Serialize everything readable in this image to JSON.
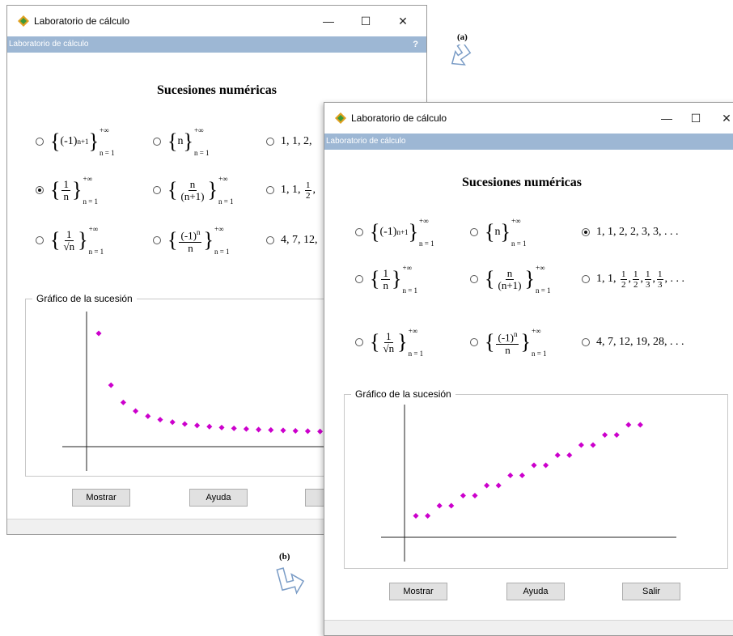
{
  "app": {
    "title": "Laboratorio de cálculo",
    "menu_label": "Laboratorio de cálculo",
    "help_mark": "?",
    "minimize": "—",
    "maximize": "☐",
    "close": "✕"
  },
  "heading": "Sucesiones numéricas",
  "options_text": {
    "list_1": "1, 1, 2, 2, 3, 3, . . .",
    "list_1_truncated": "1, 1, 2,",
    "list_2_prefix": "1, 1,",
    "list_2_suffix": ", . . .",
    "list_3": "4, 7, 12, 19, 28, . . .",
    "list_3_truncated": "4, 7, 12,"
  },
  "math_tokens": {
    "neg_one": "(-1)",
    "n_plus_1": "n+1",
    "n": "n",
    "inf": "+∞",
    "n_eq_1": "n = 1",
    "one": "1",
    "n_plus_1_paren": "(n+1)",
    "sqrt_n": "√n",
    "neg_one_n": "(-1)",
    "two": "2",
    "three": "3"
  },
  "graph_label": "Gráfico de la sucesión",
  "buttons": {
    "show": "Mostrar",
    "help": "Ayuda",
    "exit": "Salir",
    "exit_truncated": "S"
  },
  "captions": {
    "a": "(a)",
    "b": "(b)"
  },
  "windows": [
    {
      "selected_option": "1/n"
    },
    {
      "selected_option": "1, 1, 2, 2, 3, 3, . . ."
    }
  ],
  "chart_data": [
    {
      "type": "scatter",
      "series": [
        {
          "values": [
            1,
            0.5,
            0.333,
            0.25,
            0.2,
            0.167,
            0.143,
            0.125,
            0.111,
            0.1,
            0.091,
            0.083,
            0.077,
            0.071,
            0.067,
            0.063,
            0.059,
            0.056,
            0.053
          ]
        }
      ],
      "x": [
        1,
        2,
        3,
        4,
        5,
        6,
        7,
        8,
        9,
        10,
        11,
        12,
        13,
        14,
        15,
        16,
        17,
        18,
        19
      ],
      "color": "#cc00cc",
      "axes_visible": true,
      "grid": false
    },
    {
      "type": "scatter",
      "series": [
        {
          "values": [
            1,
            1,
            2,
            2,
            3,
            3,
            4,
            4,
            5,
            5,
            6,
            6,
            7,
            7,
            8,
            8,
            9,
            9,
            10,
            10
          ]
        }
      ],
      "x": [
        1,
        2,
        3,
        4,
        5,
        6,
        7,
        8,
        9,
        10,
        11,
        12,
        13,
        14,
        15,
        16,
        17,
        18,
        19,
        20
      ],
      "color": "#cc00cc",
      "axes_visible": true,
      "grid": false
    }
  ],
  "colors": {
    "menubar": "#9db7d4",
    "points": "#cc00cc",
    "button_face": "#e1e1e1"
  }
}
